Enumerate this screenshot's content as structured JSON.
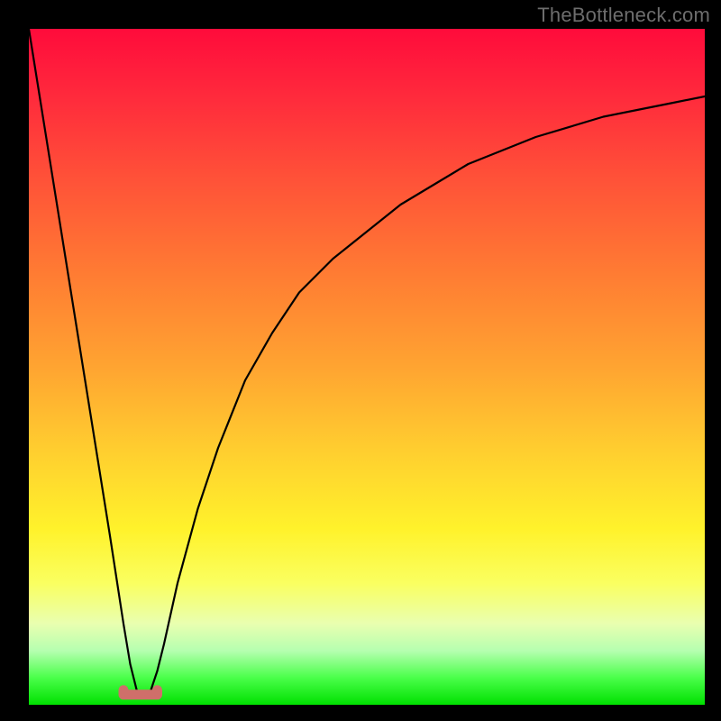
{
  "watermark": {
    "text": "TheBottleneck.com"
  },
  "chart_data": {
    "type": "line",
    "title": "",
    "xlabel": "",
    "ylabel": "",
    "xlim": [
      0,
      100
    ],
    "ylim": [
      0,
      100
    ],
    "grid": false,
    "legend": false,
    "notes": "Background is a vertical gradient from red (high y) through orange/yellow to green (low y). Black curve drops from top-left to a minimum near x≈16 then rises logarithmically toward top-right. Small salmon bracket marker at the minimum along the bottom edge.",
    "series": [
      {
        "name": "curve",
        "color": "#000000",
        "x": [
          0,
          4,
          8,
          12,
          14,
          15,
          16,
          17,
          18,
          19,
          20,
          22,
          25,
          28,
          32,
          36,
          40,
          45,
          50,
          55,
          60,
          65,
          70,
          75,
          80,
          85,
          90,
          95,
          100
        ],
        "y": [
          100,
          75,
          50,
          25,
          12,
          6,
          2,
          1,
          2,
          5,
          9,
          18,
          29,
          38,
          48,
          55,
          61,
          66,
          70,
          74,
          77,
          80,
          82,
          84,
          85.5,
          87,
          88,
          89,
          90
        ]
      }
    ],
    "marker": {
      "name": "min-bracket",
      "color": "#cf6f6a",
      "x_range": [
        14,
        19
      ],
      "y": 1.5
    }
  }
}
